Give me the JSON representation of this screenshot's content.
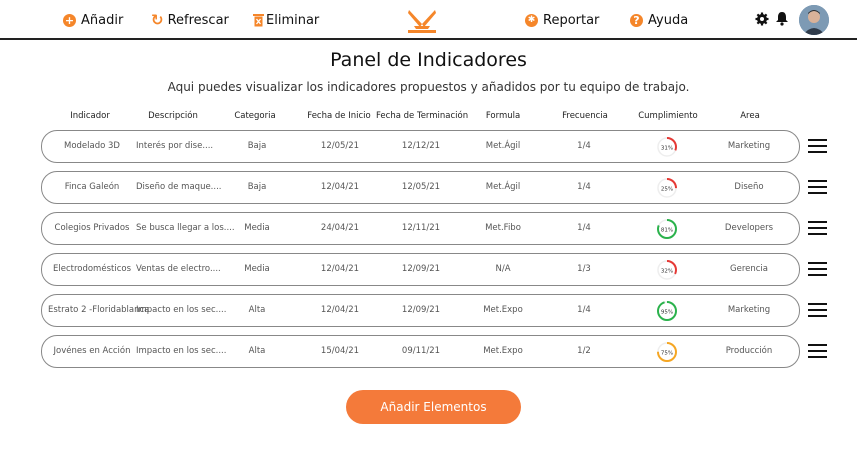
{
  "toolbar": {
    "add_label": "Añadir",
    "refresh_label": "Refrescar",
    "delete_label": "Eliminar",
    "report_label": "Reportar",
    "help_label": "Ayuda"
  },
  "colors": {
    "accent": "#f5862a",
    "good": "#2bb24c",
    "bad": "#e53935",
    "mid": "#f5a623"
  },
  "page": {
    "title": "Panel de Indicadores",
    "subtitle": "Aqui puedes visualizar los indicadores propuestos y añadidos por tu equipo de trabajo."
  },
  "table": {
    "headers": [
      "Indicador",
      "Descripción",
      "Categoria",
      "Fecha de Inicio",
      "Fecha de Terminación",
      "Formula",
      "Frecuencia",
      "Cumplimiento",
      "Area"
    ],
    "rows": [
      {
        "indicador": "Modelado 3D",
        "descripcion": "Interés por dise....",
        "categoria": "Baja",
        "inicio": "12/05/21",
        "fin": "12/12/21",
        "formula": "Met.Ágil",
        "frecuencia": "1/4",
        "cumplimiento": "31%",
        "pct": 31,
        "color": "bad",
        "area": "Marketing"
      },
      {
        "indicador": "Finca Galeón",
        "descripcion": "Diseño de maque....",
        "categoria": "Baja",
        "inicio": "12/04/21",
        "fin": "12/05/21",
        "formula": "Met.Ágil",
        "frecuencia": "1/4",
        "cumplimiento": "25%",
        "pct": 25,
        "color": "bad",
        "area": "Diseño"
      },
      {
        "indicador": "Colegios Privados",
        "descripcion": "Se busca llegar a los....",
        "categoria": "Media",
        "inicio": "24/04/21",
        "fin": "12/11/21",
        "formula": "Met.Fibo",
        "frecuencia": "1/4",
        "cumplimiento": "81%",
        "pct": 81,
        "color": "good",
        "area": "Developers"
      },
      {
        "indicador": "Electrodomésticos",
        "descripcion": "Ventas de electro....",
        "categoria": "Media",
        "inicio": "12/04/21",
        "fin": "12/09/21",
        "formula": "N/A",
        "frecuencia": "1/3",
        "cumplimiento": "32%",
        "pct": 32,
        "color": "bad",
        "area": "Gerencia"
      },
      {
        "indicador": "Estrato 2 -Floridablanca",
        "descripcion": "Impacto en los sec....",
        "categoria": "Alta",
        "inicio": "12/04/21",
        "fin": "12/09/21",
        "formula": "Met.Expo",
        "frecuencia": "1/4",
        "cumplimiento": "95%",
        "pct": 95,
        "color": "good",
        "area": "Marketing"
      },
      {
        "indicador": "Jovénes en Acción",
        "descripcion": "Impacto en los sec....",
        "categoria": "Alta",
        "inicio": "15/04/21",
        "fin": "09/11/21",
        "formula": "Met.Expo",
        "frecuencia": "1/2",
        "cumplimiento": "75%",
        "pct": 75,
        "color": "mid",
        "area": "Producción"
      }
    ]
  },
  "footer": {
    "add_elements_label": "Añadir Elementos"
  }
}
